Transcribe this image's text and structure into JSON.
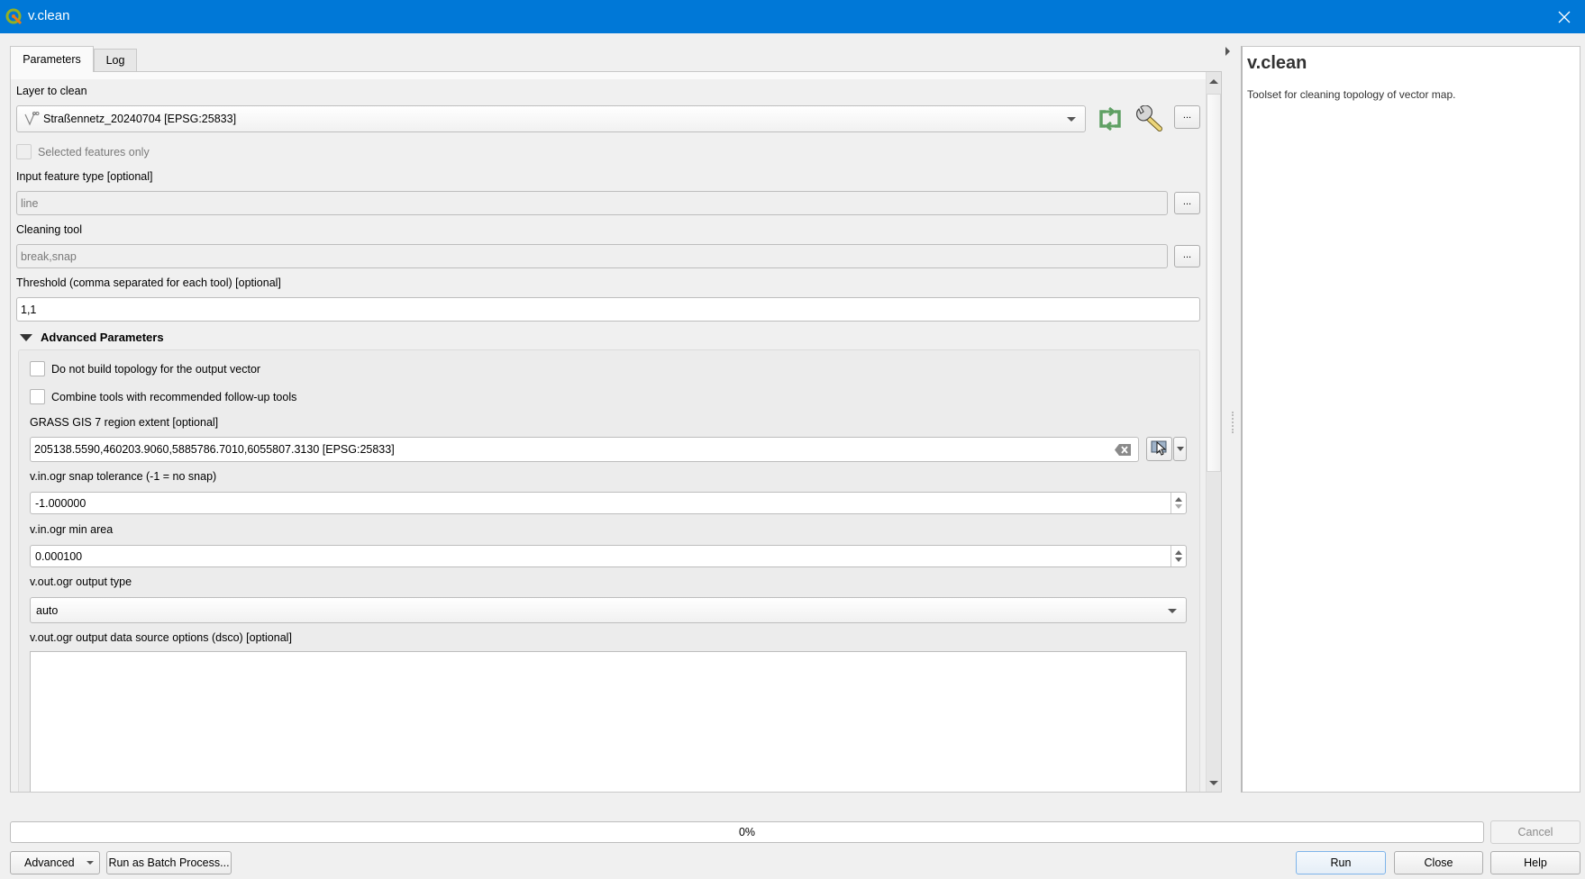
{
  "window": {
    "title": "v.clean",
    "icon": "qgis-logo-icon",
    "close_icon": "close-icon"
  },
  "tabs": [
    {
      "label": "Parameters",
      "active": true
    },
    {
      "label": "Log",
      "active": false
    }
  ],
  "params": {
    "layer": {
      "label": "Layer to clean",
      "value": "Straßennetz_20240704 [EPSG:25833]",
      "layer_icon": "line-layer-icon",
      "iterate_icon": "iterate-icon",
      "settings_icon": "wrench-icon",
      "more_label": "..."
    },
    "selected_only": {
      "label": "Selected features only",
      "checked": false,
      "enabled": false
    },
    "feature_type": {
      "label": "Input feature type [optional]",
      "value": "line",
      "more_label": "..."
    },
    "cleaning_tool": {
      "label": "Cleaning tool",
      "value": "break,snap",
      "more_label": "..."
    },
    "threshold": {
      "label": "Threshold (comma separated for each tool) [optional]",
      "value": "1,1"
    },
    "advanced": {
      "header": "Advanced Parameters",
      "expanded": true,
      "no_topology": {
        "label": "Do not build topology for the output vector",
        "checked": false
      },
      "combine_tools": {
        "label": "Combine tools with recommended follow-up tools",
        "checked": false
      },
      "region_extent": {
        "label": "GRASS GIS 7 region extent [optional]",
        "value": "205138.5590,460203.9060,5885786.7010,6055807.3130 [EPSG:25833]",
        "clear_icon": "clear-icon",
        "select_icon": "select-on-canvas-icon"
      },
      "snap_tolerance": {
        "label": "v.in.ogr snap tolerance (-1 = no snap)",
        "value": "-1.000000"
      },
      "min_area": {
        "label": "v.in.ogr min area",
        "value": "0.000100"
      },
      "output_type": {
        "label": "v.out.ogr output type",
        "value": "auto"
      },
      "dsco": {
        "label": "v.out.ogr output data source options (dsco) [optional]",
        "value": ""
      }
    }
  },
  "help": {
    "title": "v.clean",
    "description": "Toolset for cleaning topology of vector map."
  },
  "progress": {
    "value_percent": 0,
    "label": "0%"
  },
  "buttons": {
    "cancel": "Cancel",
    "advanced": "Advanced",
    "batch": "Run as Batch Process...",
    "run": "Run",
    "close": "Close",
    "help": "Help"
  },
  "colors": {
    "titlebar": "#0078d7",
    "run_border": "#7eb4ea"
  }
}
